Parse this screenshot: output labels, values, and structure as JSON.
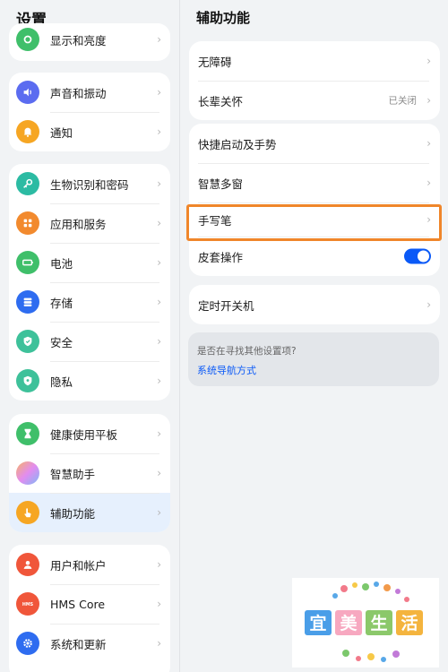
{
  "left": {
    "title": "设置",
    "groups": [
      [
        {
          "label": "显示和亮度",
          "icon": "brightness-icon",
          "color": "#3fbf6a"
        }
      ],
      [
        {
          "label": "声音和振动",
          "icon": "speaker-icon",
          "color": "#5b6cf0"
        },
        {
          "label": "通知",
          "icon": "bell-icon",
          "color": "#f6a623"
        }
      ],
      [
        {
          "label": "生物识别和密码",
          "icon": "key-icon",
          "color": "#2cbba3"
        },
        {
          "label": "应用和服务",
          "icon": "apps-icon",
          "color": "#f28a2e"
        },
        {
          "label": "电池",
          "icon": "battery-icon",
          "color": "#3fbf6a"
        },
        {
          "label": "存储",
          "icon": "storage-icon",
          "color": "#2e6cf0"
        },
        {
          "label": "安全",
          "icon": "shield-icon",
          "color": "#3ec19a"
        },
        {
          "label": "隐私",
          "icon": "privacy-icon",
          "color": "#3ec19a"
        }
      ],
      [
        {
          "label": "健康使用平板",
          "icon": "hourglass-icon",
          "color": "#3fbf6a"
        },
        {
          "label": "智慧助手",
          "icon": "assistant-icon",
          "color": "#c88cf0"
        },
        {
          "label": "辅助功能",
          "icon": "hand-icon",
          "color": "#f6a623",
          "selected": true
        }
      ],
      [
        {
          "label": "用户和帐户",
          "icon": "user-icon",
          "color": "#f0563a"
        },
        {
          "label": "HMS Core",
          "icon": "hms-icon",
          "color": "#f0563a"
        },
        {
          "label": "系统和更新",
          "icon": "gear-icon",
          "color": "#2e6cf0"
        }
      ]
    ]
  },
  "right": {
    "title": "辅助功能",
    "items": [
      {
        "label": "无障碍"
      },
      {
        "label": "长辈关怀",
        "value": "已关闭"
      },
      {
        "label": "快捷启动及手势"
      },
      {
        "label": "智慧多窗"
      },
      {
        "label": "手写笔"
      },
      {
        "label": "皮套操作",
        "toggle_on": true
      },
      {
        "label": "定时开关机"
      }
    ],
    "hint": {
      "question": "是否在寻找其他设置项?",
      "link": "系统导航方式"
    }
  },
  "watermark": {
    "text": "宜美生活"
  },
  "colors": {
    "accent": "#0a59f7",
    "highlight": "#f0862a"
  }
}
